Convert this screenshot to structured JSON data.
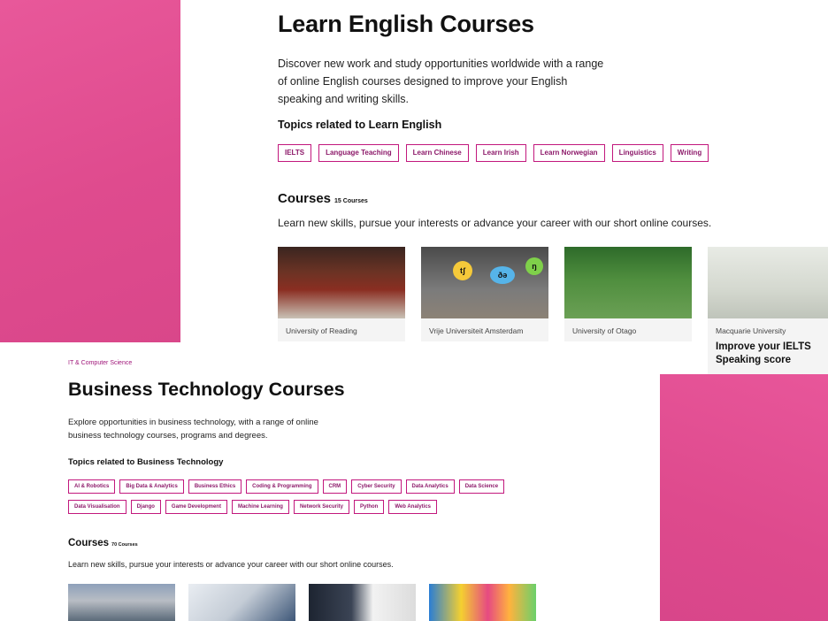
{
  "english": {
    "title": "Learn English Courses",
    "description": "Discover new work and study opportunities worldwide with a range of online English courses designed to improve your English speaking and writing skills.",
    "topics_heading": "Topics related to Learn English",
    "topics": [
      "IELTS",
      "Language Teaching",
      "Learn Chinese",
      "Learn Irish",
      "Learn Norwegian",
      "Linguistics",
      "Writing"
    ],
    "courses_heading": "Courses",
    "courses_count": "15 Courses",
    "courses_intro": "Learn new skills, pursue your interests or advance your career with our short online courses.",
    "cards": [
      {
        "university": "University of Reading",
        "title": ""
      },
      {
        "university": "Vrije Universiteit Amsterdam",
        "title": "",
        "bubbles": [
          "tʃ",
          "ðə",
          "ŋ"
        ]
      },
      {
        "university": "University of Otago",
        "title": ""
      },
      {
        "university": "Macquarie University",
        "title": "Improve your IELTS Speaking score"
      }
    ]
  },
  "business": {
    "category": "IT & Computer Science",
    "title": "Business Technology Courses",
    "description": "Explore opportunities in business technology, with a range of online business technology courses, programs and degrees.",
    "topics_heading": "Topics related to Business Technology",
    "topics_row1": [
      "AI & Robotics",
      "Big Data & Analytics",
      "Business Ethics",
      "Coding & Programming",
      "CRM",
      "Cyber Security",
      "Data Analytics",
      "Data Science"
    ],
    "topics_row2": [
      "Data Visualisation",
      "Django",
      "Game Development",
      "Machine Learning",
      "Network Security",
      "Python",
      "Web Analytics"
    ],
    "courses_heading": "Courses",
    "courses_count": "70 Courses",
    "courses_intro": "Learn new skills, pursue your interests or advance your career with our short online courses."
  },
  "colors": {
    "accent_pink": "#df4b8e",
    "tag_border": "#c2187d",
    "tag_text": "#8d1a6a"
  }
}
